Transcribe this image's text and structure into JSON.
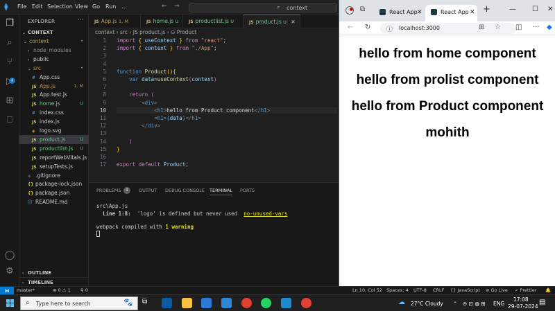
{
  "vscode": {
    "menu": [
      "File",
      "Edit",
      "Selection",
      "View",
      "Go",
      "Run",
      "…"
    ],
    "search_text": "context",
    "explorer": {
      "title": "EXPLORER",
      "root": "CONTEXT",
      "items": [
        {
          "label": "context",
          "status": "•",
          "status_color": "#c09553",
          "color": "#c09553",
          "indent": 1,
          "chev": "⌄",
          "icon": ""
        },
        {
          "label": "node_modules",
          "status": "",
          "color": "#8c8c8c",
          "indent": 2,
          "chev": "›",
          "icon": ""
        },
        {
          "label": "public",
          "status": "",
          "color": "#cccccc",
          "indent": 2,
          "chev": "›",
          "icon": ""
        },
        {
          "label": "src",
          "status": "•",
          "status_color": "#c09553",
          "color": "#c09553",
          "indent": 2,
          "chev": "⌄",
          "icon": ""
        },
        {
          "label": "App.css",
          "status": "",
          "color": "#cccccc",
          "indent": 3,
          "icon": "#",
          "icon_color": "#519aba"
        },
        {
          "label": "App.js",
          "status": "1, M",
          "status_color": "#c09553",
          "color": "#c09553",
          "indent": 3,
          "icon": "JS",
          "icon_color": "#cbcb41"
        },
        {
          "label": "App.test.js",
          "status": "",
          "color": "#cccccc",
          "indent": 3,
          "icon": "JS",
          "icon_color": "#cbcb41"
        },
        {
          "label": "home.js",
          "status": "U",
          "status_color": "#73c991",
          "color": "#73c991",
          "indent": 3,
          "icon": "JS",
          "icon_color": "#cbcb41"
        },
        {
          "label": "index.css",
          "status": "",
          "color": "#cccccc",
          "indent": 3,
          "icon": "#",
          "icon_color": "#519aba"
        },
        {
          "label": "index.js",
          "status": "",
          "color": "#cccccc",
          "indent": 3,
          "icon": "JS",
          "icon_color": "#cbcb41"
        },
        {
          "label": "logo.svg",
          "status": "",
          "color": "#cccccc",
          "indent": 3,
          "icon": "◈",
          "icon_color": "#e4a13a"
        },
        {
          "label": "product.js",
          "status": "U",
          "status_color": "#73c991",
          "color": "#73c991",
          "indent": 3,
          "icon": "JS",
          "icon_color": "#cbcb41",
          "selected": true
        },
        {
          "label": "productlist.js",
          "status": "U",
          "status_color": "#73c991",
          "color": "#73c991",
          "indent": 3,
          "icon": "JS",
          "icon_color": "#cbcb41"
        },
        {
          "label": "reportWebVitals.js",
          "status": "",
          "color": "#cccccc",
          "indent": 3,
          "icon": "JS",
          "icon_color": "#cbcb41"
        },
        {
          "label": "setupTests.js",
          "status": "",
          "color": "#cccccc",
          "indent": 3,
          "icon": "JS",
          "icon_color": "#cbcb41"
        },
        {
          "label": ".gitignore",
          "status": "",
          "color": "#cccccc",
          "indent": 2,
          "icon": "◆",
          "icon_color": "#41535b"
        },
        {
          "label": "package-lock.json",
          "status": "",
          "color": "#cccccc",
          "indent": 2,
          "icon": "{}",
          "icon_color": "#cbcb41"
        },
        {
          "label": "package.json",
          "status": "",
          "color": "#cccccc",
          "indent": 2,
          "icon": "{}",
          "icon_color": "#cbcb41"
        },
        {
          "label": "README.md",
          "status": "",
          "color": "#cccccc",
          "indent": 2,
          "icon": "ⓘ",
          "icon_color": "#519aba"
        }
      ],
      "outline": "OUTLINE",
      "timeline": "TIMELINE"
    },
    "tabs": [
      {
        "label": "App.js",
        "status": "1, M",
        "status_color": "#c09553",
        "label_color": "#c09553"
      },
      {
        "label": "home.js",
        "status": "U",
        "status_color": "#73c991",
        "label_color": "#73c991"
      },
      {
        "label": "productlist.js",
        "status": "U",
        "status_color": "#73c991",
        "label_color": "#73c991"
      },
      {
        "label": "product.js",
        "status": "U",
        "status_color": "#73c991",
        "label_color": "#73c991",
        "active": true
      }
    ],
    "breadcrumb": "context › src › JS product.js › ⊙ Product",
    "code_lines": [
      {
        "n": "1",
        "html": "<span style='color:#c586c0'>import</span> <span style='color:#ffd700'>{</span> <span style='color:#9cdcfe'>useContext</span> <span style='color:#ffd700'>}</span> <span style='color:#c586c0'>from</span> <span style='color:#ce9178'>\"react\"</span>;"
      },
      {
        "n": "2",
        "html": "<span style='color:#c586c0'>import</span> <span style='color:#ffd700'>{</span> <span style='color:#9cdcfe'>context</span> <span style='color:#ffd700'>}</span> <span style='color:#c586c0'>from</span> <span style='color:#ce9178'>\"./App\"</span>;"
      },
      {
        "n": "3",
        "html": ""
      },
      {
        "n": "4",
        "html": ""
      },
      {
        "n": "5",
        "html": "<span style='color:#569cd6'>function</span> <span style='color:#dcdcaa'>Product</span><span style='color:#ffd700'>()</span><span style='color:#ffd700'>{</span>"
      },
      {
        "n": "6",
        "html": "    <span style='color:#569cd6'>var</span> <span style='color:#9cdcfe'>data</span>=<span style='color:#dcdcaa'>useContext</span><span style='color:#da70d6'>(</span><span style='color:#9cdcfe'>context</span><span style='color:#da70d6'>)</span>"
      },
      {
        "n": "7",
        "html": ""
      },
      {
        "n": "8",
        "html": "    <span style='color:#c586c0'>return</span> <span style='color:#da70d6'>(</span>"
      },
      {
        "n": "9",
        "html": "        <span style='color:#808080'>&lt;</span><span style='color:#569cd6'>div</span><span style='color:#808080'>&gt;</span>"
      },
      {
        "n": "10",
        "html": "            <span style='color:#808080'>&lt;</span><span style='color:#569cd6'>h1</span><span style='color:#808080'>&gt;</span>hello from Product component<span style='color:#808080'>&lt;/</span><span style='color:#569cd6'>h1</span><span style='color:#808080'>&gt;</span>",
        "current": true
      },
      {
        "n": "11",
        "html": "            <span style='color:#808080'>&lt;</span><span style='color:#569cd6'>h1</span><span style='color:#808080'>&gt;</span><span style='color:#569cd6'>{</span><span style='color:#9cdcfe'>data</span><span style='color:#569cd6'>}</span><span style='color:#808080'>&lt;/</span><span style='color:#569cd6'>h1</span><span style='color:#808080'>&gt;</span>"
      },
      {
        "n": "12",
        "html": "        <span style='color:#808080'>&lt;/</span><span style='color:#569cd6'>div</span><span style='color:#808080'>&gt;</span>"
      },
      {
        "n": "13",
        "html": ""
      },
      {
        "n": "14",
        "html": "    <span style='color:#da70d6'>)</span>"
      },
      {
        "n": "15",
        "html": "<span style='color:#ffd700'>}</span>"
      },
      {
        "n": "16",
        "html": ""
      },
      {
        "n": "17",
        "html": "<span style='color:#c586c0'>export</span> <span style='color:#c586c0'>default</span> <span style='color:#9cdcfe'>Product</span>;"
      }
    ],
    "panel_tabs": {
      "problems": "PROBLEMS",
      "problems_count": "1",
      "output": "OUTPUT",
      "debug": "DEBUG CONSOLE",
      "terminal": "TERMINAL",
      "ports": "PORTS"
    },
    "terminal": {
      "l1": "src\\App.js",
      "l2a": "  Line 1:8:",
      "l2b": "  'logo' is defined but never used  ",
      "l2c": "no-unused-vars",
      "l3a": "webpack compiled with ",
      "l3b": "1 warning"
    },
    "status": {
      "branch": "master*",
      "errors": "⊗ 0 ⚠ 1",
      "ports": "⚲ 0",
      "ln": "Ln 10, Col 52",
      "spaces": "Spaces: 4",
      "enc": "UTF-8",
      "eol": "CRLF",
      "lang": "{} JavaScript",
      "live": "⊘ Go Live",
      "prettier": "✓ Prettier"
    }
  },
  "browser": {
    "tabs": [
      {
        "label": "React App"
      },
      {
        "label": "React App",
        "active": true
      }
    ],
    "url": "localhost:3000",
    "content": [
      "hello from home component",
      "hello from prolist component",
      "hello from Product component",
      "mohith"
    ]
  },
  "taskbar": {
    "search_placeholder": "Type here to search",
    "weather": "27°C  Cloudy",
    "lang": "ENG",
    "time": "17:08",
    "date": "29-07-2024"
  }
}
